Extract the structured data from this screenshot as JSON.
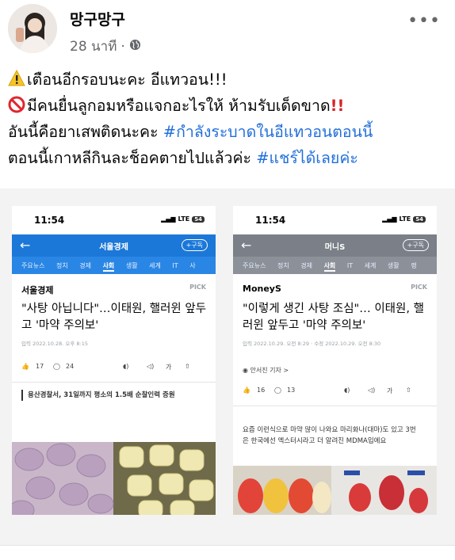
{
  "post": {
    "author": "망구망구",
    "time": "28 นาที",
    "separator": "·",
    "more_label": "•••",
    "line1": "เตือนอีกรอบนะคะ อีแทวอน!!!",
    "line2": "มีคนยื่นลูกอมหรือแจกอะไรให้ ห้ามรับเด็ดขาด",
    "line2_bang": "!!",
    "line3_text": "อันนี้คือยาเสพติดนะคะ ",
    "line3_tag": "#กำลังระบาดในอีแทวอนตอนนี้",
    "line4_text": "ตอนนี้เกาหลีกินละช็อคตายไปแล้วค่ะ ",
    "line4_tag": "#แชร์ได้เลยค่ะ"
  },
  "left_phone": {
    "time": "11:54",
    "signal": "LTE",
    "battery": "54",
    "bar_title": "서울경제",
    "subscribe": "+구독",
    "categories": [
      "주요뉴스",
      "정치",
      "경제",
      "사회",
      "생활",
      "세계",
      "IT",
      "사"
    ],
    "active_category": "사회",
    "source": "서울경제",
    "pick": "PICK",
    "headline": "\"사탕 아닙니다\"…이태원, 핼러윈 앞두고 '마약 주의보'",
    "date": "입력 2022.10.28. 오후 8:15",
    "like_count": "17",
    "comment_count": "24",
    "font_size_label": "가",
    "excerpt": "용산경찰서, 31일까지 평소의 1.5배 순찰인력 증원"
  },
  "right_phone": {
    "time": "11:54",
    "signal": "LTE",
    "battery": "54",
    "bar_title": "머니S",
    "subscribe": "+구독",
    "categories": [
      "주요뉴스",
      "정치",
      "경제",
      "사회",
      "IT",
      "세계",
      "생활",
      "랭"
    ],
    "active_category": "사회",
    "source": "MoneyS",
    "pick": "PICK",
    "headline": "\"이렇게 생긴 사탕 조심\"… 이태원, 핼러윈 앞두고 '마약 주의보'",
    "date": "입력 2022.10.29. 오전 8:29 · 수정 2022.10.29. 오전 8:30",
    "reporter": "안서진 기자 >",
    "like_count": "16",
    "comment_count": "13",
    "font_size_label": "가",
    "excerpt": "요즘 이런식으로 마약 많이 나와요 마리화나(대마)도 있고 3번은 한국에선 엑스터시라고 더 알려진 MDMA입에요"
  },
  "colors": {
    "hashtag": "#216fdb",
    "left_brand": "#1c78d8",
    "right_brand": "#7a7f88",
    "bang": "#d8222a"
  }
}
